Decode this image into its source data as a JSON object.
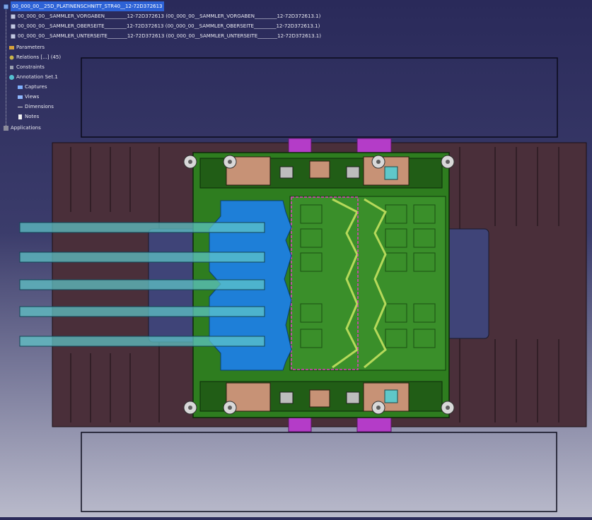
{
  "spec_tree": {
    "root": "00_000_00__25D_PLATINENSCHNITT_STR40__12-72D372613",
    "products": [
      "00_000_00__SAMMLER_VORGABEN_________12-72D372613 (00_000_00__SAMMLER_VORGABEN_________12-72D372613.1)",
      "00_000_00__SAMMLER_OBERSEITE_________12-72D372613 (00_000_00__SAMMLER_OBERSEITE_________12-72D372613.1)",
      "00_000_00__SAMMLER_UNTERSEITE________12-72D372613 (00_000_00__SAMMLER_UNTERSEITE________12-72D372613.1)"
    ],
    "parameters": "Parameters",
    "relations": "Relations [...] (45)",
    "constraints": "Constraints",
    "annotation_set": "Annotation Set.1",
    "annotation_children": [
      "Captures",
      "Views",
      "Dimensions",
      "Notes"
    ],
    "applications": "Applications"
  },
  "colors": {
    "background_top": "#2a2a5a",
    "background_bottom": "#b9bacb",
    "die_base": "#4a2f3a",
    "die_plate_green": "#2e7d1f",
    "blank_blue": "#1e7fd8",
    "selection_pink": "#e040c0",
    "handle_magenta": "#b43cc8",
    "feeder_cyan": "#5fc7c9"
  },
  "icons": {
    "product": "product-icon",
    "parameters": "parameters-icon",
    "relations": "relations-icon",
    "constraints": "constraints-icon",
    "annotation": "annotation-set-icon",
    "captures": "captures-icon",
    "views": "views-icon",
    "dimensions": "dimensions-icon",
    "notes": "notes-icon",
    "applications": "applications-icon"
  }
}
